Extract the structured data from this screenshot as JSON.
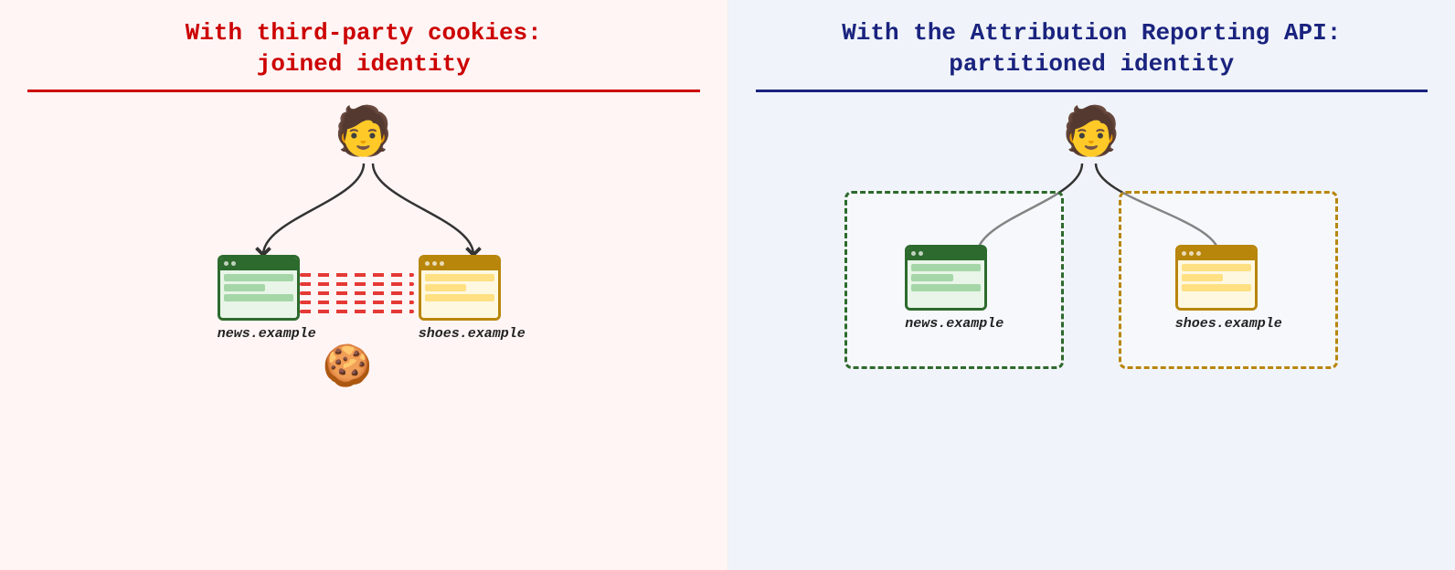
{
  "left": {
    "title_line1": "With third-party cookies:",
    "title_line2": "joined identity",
    "site_left": "news.example",
    "site_right": "shoes.example"
  },
  "right": {
    "title_line1": "With the Attribution Reporting API:",
    "title_line2": "partitioned identity",
    "site_left": "news.example",
    "site_right": "shoes.example"
  }
}
